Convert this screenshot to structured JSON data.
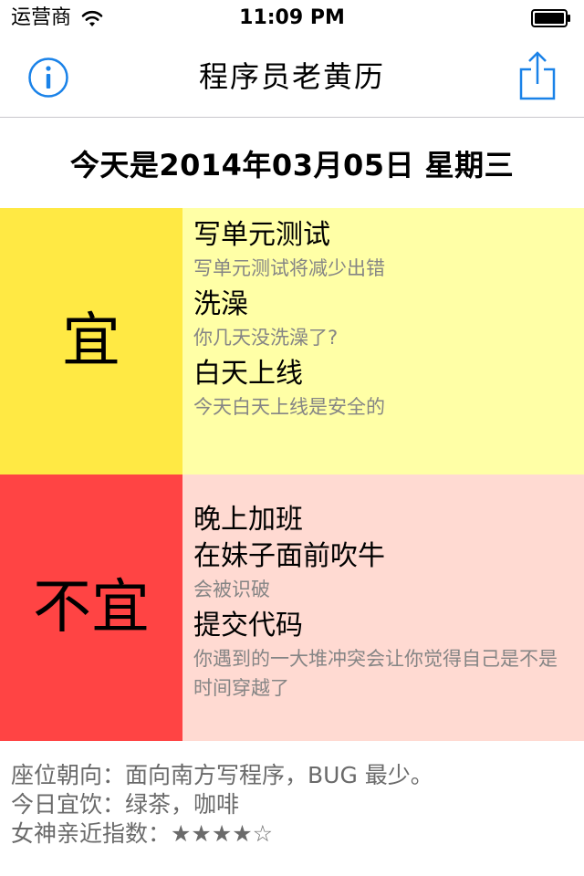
{
  "status_bar": {
    "carrier": "运营商",
    "time": "11:09 PM",
    "icons": [
      "wifi-icon",
      "battery-icon"
    ]
  },
  "nav": {
    "title": "程序员老黄历",
    "left_icon": "info-icon",
    "right_icon": "share-icon",
    "accent_color": "#1a82e8"
  },
  "date_text": "今天是2014年03月05日 星期三",
  "good": {
    "label": "宜",
    "label_bg": "#ffe944",
    "panel_bg": "#ffffa6",
    "items": [
      {
        "title": "写单元测试",
        "desc": "写单元测试将减少出错"
      },
      {
        "title": "洗澡",
        "desc": "你几天没洗澡了?"
      },
      {
        "title": "白天上线",
        "desc": "今天白天上线是安全的"
      }
    ]
  },
  "bad": {
    "label": "不宜",
    "label_bg": "#ff4444",
    "panel_bg": "#ffdad2",
    "items": [
      {
        "title": "晚上加班",
        "desc": ""
      },
      {
        "title": "在妹子面前吹牛",
        "desc": "会被识破"
      },
      {
        "title": "提交代码",
        "desc": "你遇到的一大堆冲突会让你觉得自己是不是时间穿越了"
      }
    ]
  },
  "footer": {
    "seat": "座位朝向：面向南方写程序，BUG 最少。",
    "drink": "今日宜饮：绿茶，咖啡",
    "goddess": "女神亲近指数：★★★★☆",
    "goddess_rating": 4,
    "goddess_rating_max": 5
  }
}
